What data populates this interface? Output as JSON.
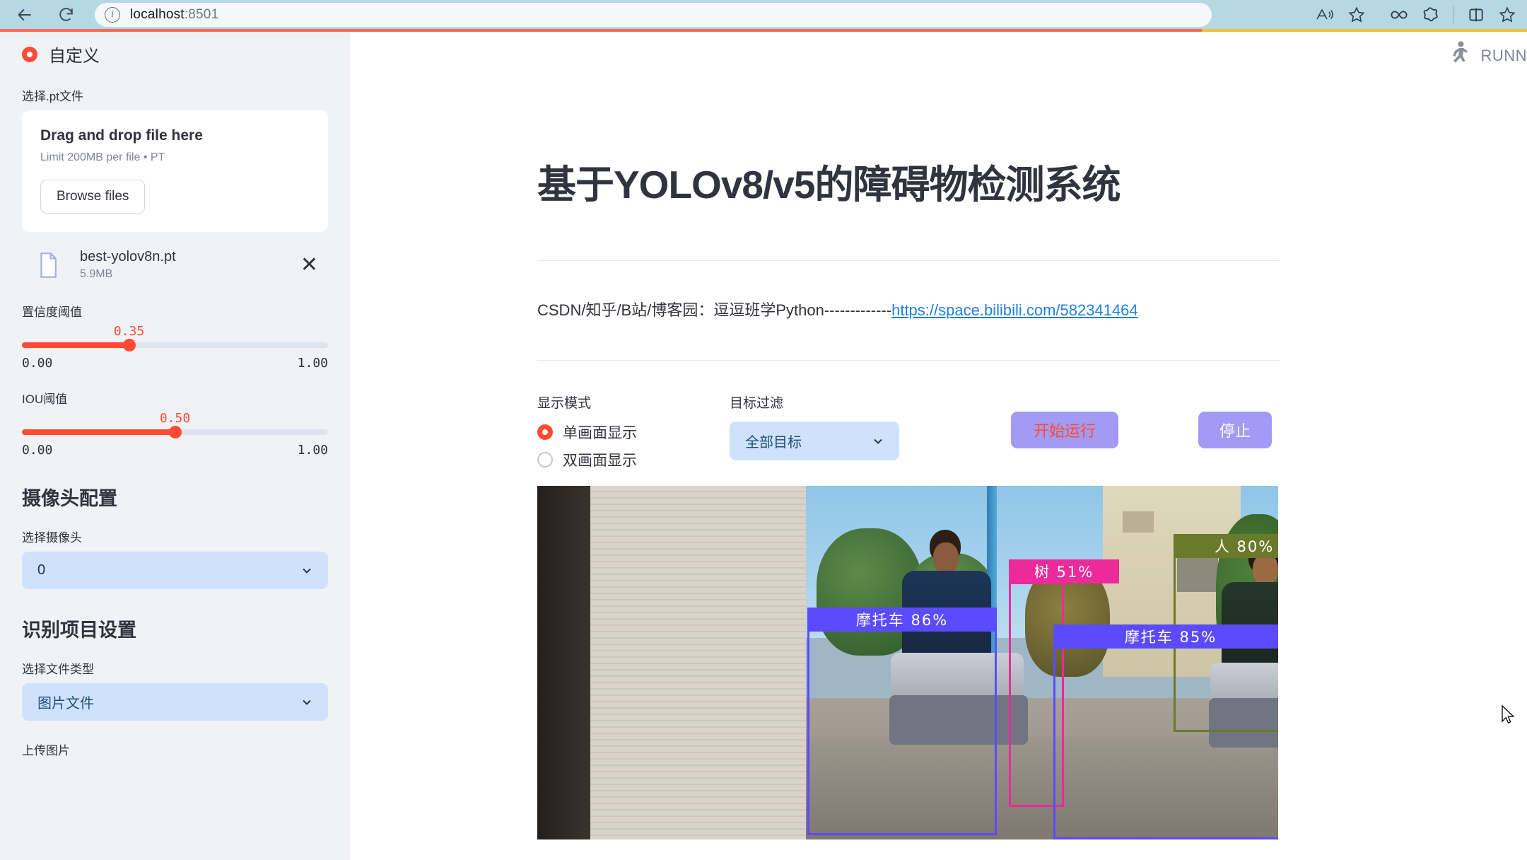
{
  "browser": {
    "url": "localhost:8501",
    "url_host": "localhost",
    "url_port": ":8501",
    "back_icon": "back-arrow-icon",
    "reload_icon": "reload-icon",
    "info_icon": "info-icon",
    "read_aloud_icon": "read-aloud-icon",
    "favorite_icon": "star-icon",
    "infinity_icon": "infinity-icon",
    "copilot_icon": "copilot-icon",
    "split_icon": "split-screen-icon",
    "collections_icon": "collections-star-icon"
  },
  "sidebar": {
    "header": "自定义",
    "header_icon": "radio-selected-icon",
    "model_file_label": "选择.pt文件",
    "dropzone": {
      "title": "Drag and drop file here",
      "limit": "Limit 200MB per file • PT",
      "browse": "Browse files"
    },
    "uploaded_file": {
      "icon": "file-icon",
      "name": "best-yolov8n.pt",
      "size": "5.9MB",
      "remove_icon": "close-icon"
    },
    "conf_slider": {
      "label": "置信度阈值",
      "value": "0.35",
      "min": "0.00",
      "max": "1.00",
      "percent": 35
    },
    "iou_slider": {
      "label": "IOU阈值",
      "value": "0.50",
      "min": "0.00",
      "max": "1.00",
      "percent": 50
    },
    "camera_section": {
      "heading": "摄像头配置",
      "select_label": "选择摄像头",
      "select_value": "0"
    },
    "project_section": {
      "heading": "识别项目设置",
      "filetype_label": "选择文件类型",
      "filetype_value": "图片文件",
      "upload_label": "上传图片"
    }
  },
  "main": {
    "status": "RUNN",
    "status_icon": "running-person-icon",
    "title": "基于YOLOv8/v5的障碍物检测系统",
    "credit_prefix": "CSDN/知乎/B站/博客园：逗逗班学Python-------------",
    "credit_link": "https://space.bilibili.com/582341464",
    "display_mode": {
      "label": "显示模式",
      "options": [
        "单画面显示",
        "双画面显示"
      ],
      "selected": "单画面显示"
    },
    "target_filter": {
      "label": "目标过滤",
      "value": "全部目标",
      "chevron_icon": "chevron-down-icon"
    },
    "buttons": {
      "start": "开始运行",
      "stop": "停止",
      "start_color": "#ff4b33",
      "stop_color": "#ffffff",
      "bg_color": "#a39af5"
    },
    "detections": [
      {
        "label": "摩托车",
        "conf": "86%",
        "color": "#5b4bff"
      },
      {
        "label": "树",
        "conf": "51%",
        "color": "#ec2a9a"
      },
      {
        "label": "人",
        "conf": "80%",
        "color": "#6b7a2a"
      },
      {
        "label": "摩托车",
        "conf": "85%",
        "color": "#5b4bff"
      }
    ]
  },
  "colors": {
    "accent": "#ff4b33",
    "sidebar_bg": "#f0f2f6",
    "select_bg": "#cfe2fb",
    "link": "#1f7fe0",
    "chrome_bg": "#b6d7e4"
  }
}
